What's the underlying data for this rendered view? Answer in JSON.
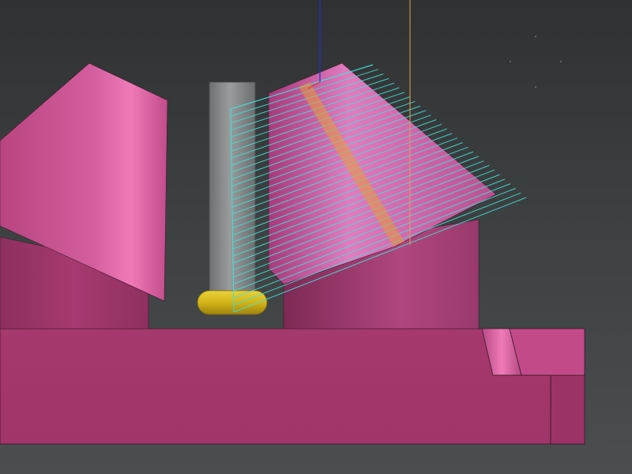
{
  "viewport": {
    "background_top": "#2f3132",
    "background_bottom": "#4b4e4f"
  },
  "part": {
    "face_color": "#a3376b",
    "cone_light": "#f07ab8",
    "cone_mid": "#cf5497",
    "cone_dark": "#9a3468"
  },
  "tool": {
    "shank_color": "#8a8c8d",
    "tip_color": "#d4b417"
  },
  "toolpath": {
    "color": "#3fe0d8",
    "pass_count": 30
  },
  "axes": {
    "vertical_color": "#1c2fd6",
    "reference_color": "#e8a34a"
  }
}
